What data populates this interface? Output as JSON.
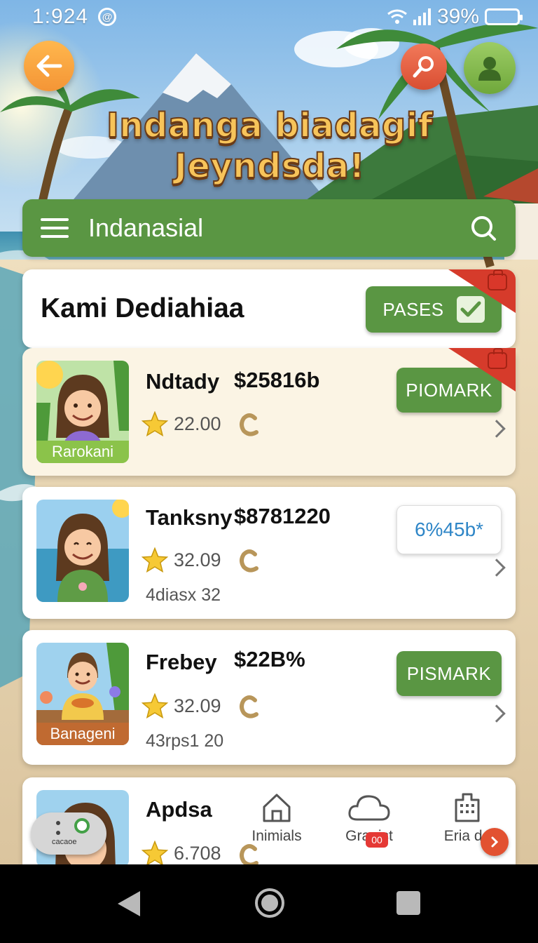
{
  "status_bar": {
    "time": "1:924",
    "at_symbol": "@",
    "battery_text": "39%",
    "battery_level": 0.3,
    "battery_color": "#e53935"
  },
  "header": {
    "back_icon": "arrow-left-icon",
    "search_icon": "magnifier-icon",
    "profile_icon": "person-icon",
    "title_line1": "Indanga biadagif",
    "title_line2": "Jeyndsda!"
  },
  "search": {
    "menu_icon": "hamburger-icon",
    "label": "Indanasial",
    "icon": "search-icon"
  },
  "section": {
    "title": "Kami Dediahiaa",
    "pases_label": "PASES",
    "check_icon": "checkmark-icon"
  },
  "items": [
    {
      "name": "Ndtady",
      "price": "$25816b",
      "rating": "22.00",
      "thumb_label": "Rarokani",
      "button": "PIOMARK"
    },
    {
      "name": "Tanksny",
      "price": "$8781220",
      "rating": "32.09",
      "sub": "4diasx 32",
      "button": "6%45b*"
    },
    {
      "name": "Frebey",
      "price": "$22B%",
      "rating": "32.09",
      "sub": "43rps1 20",
      "thumb_label": "Banageni",
      "button": "PISMARK"
    },
    {
      "name": "Apdsa",
      "rating": "6.708"
    }
  ],
  "bottom_nav": [
    {
      "label": "Inimials",
      "icon": "home-icon"
    },
    {
      "label": "Granist",
      "icon": "cloud-icon",
      "badge": "00"
    },
    {
      "label": "Eria da",
      "icon": "building-icon"
    }
  ],
  "float_pill": {
    "text": "cacaoe"
  },
  "colors": {
    "primary_green": "#5a9643",
    "accent_orange": "#f49536",
    "accent_red": "#d63b2b",
    "link_blue": "#2f86c7"
  }
}
